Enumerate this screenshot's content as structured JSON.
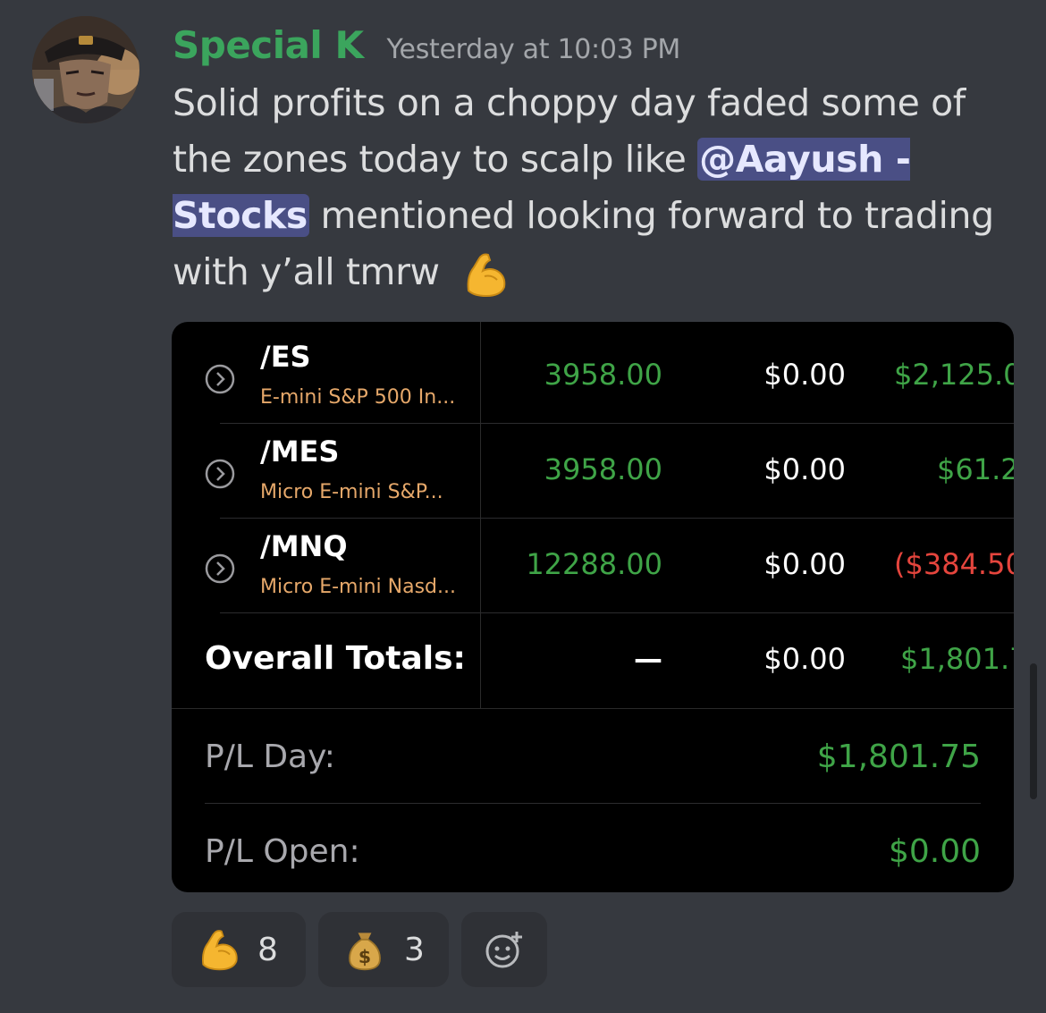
{
  "message": {
    "author": "Special K",
    "timestamp": "Yesterday at 10:03 PM",
    "text_before_mention": "Solid profits on a choppy day faded some of the zones today to scalp like ",
    "mention": "@Aayush - Stocks",
    "text_after_mention": " mentioned looking forward to trading with y’all tmrw",
    "emoji": "flexed-biceps"
  },
  "attachment": {
    "positions": [
      {
        "symbol": "/ES",
        "description": "E-mini S&P 500 In...",
        "price": "3958.00",
        "pl_open": "$0.00",
        "pl_day": "$2,125.0"
      },
      {
        "symbol": "/MES",
        "description": "Micro E-mini S&P...",
        "price": "3958.00",
        "pl_open": "$0.00",
        "pl_day": "$61.2"
      },
      {
        "symbol": "/MNQ",
        "description": "Micro E-mini Nasd...",
        "price": "12288.00",
        "pl_open": "$0.00",
        "pl_day": "($384.50"
      }
    ],
    "totals": {
      "label": "Overall Totals:",
      "price": "—",
      "pl_open": "$0.00",
      "pl_day": "$1,801.7"
    },
    "summary": {
      "pl_day_label": "P/L Day:",
      "pl_day_value": "$1,801.75",
      "pl_open_label": "P/L Open:",
      "pl_open_value": "$0.00"
    },
    "colors": {
      "positive": "#3fa447",
      "negative": "#e5453d",
      "description": "#e6a86a"
    }
  },
  "reactions": [
    {
      "emoji": "flexed-biceps",
      "count": "8"
    },
    {
      "emoji": "money-bag",
      "count": "3"
    }
  ],
  "colors": {
    "background": "#36393f",
    "username": "#3ba55d",
    "mention_bg": "#4a4f85"
  }
}
